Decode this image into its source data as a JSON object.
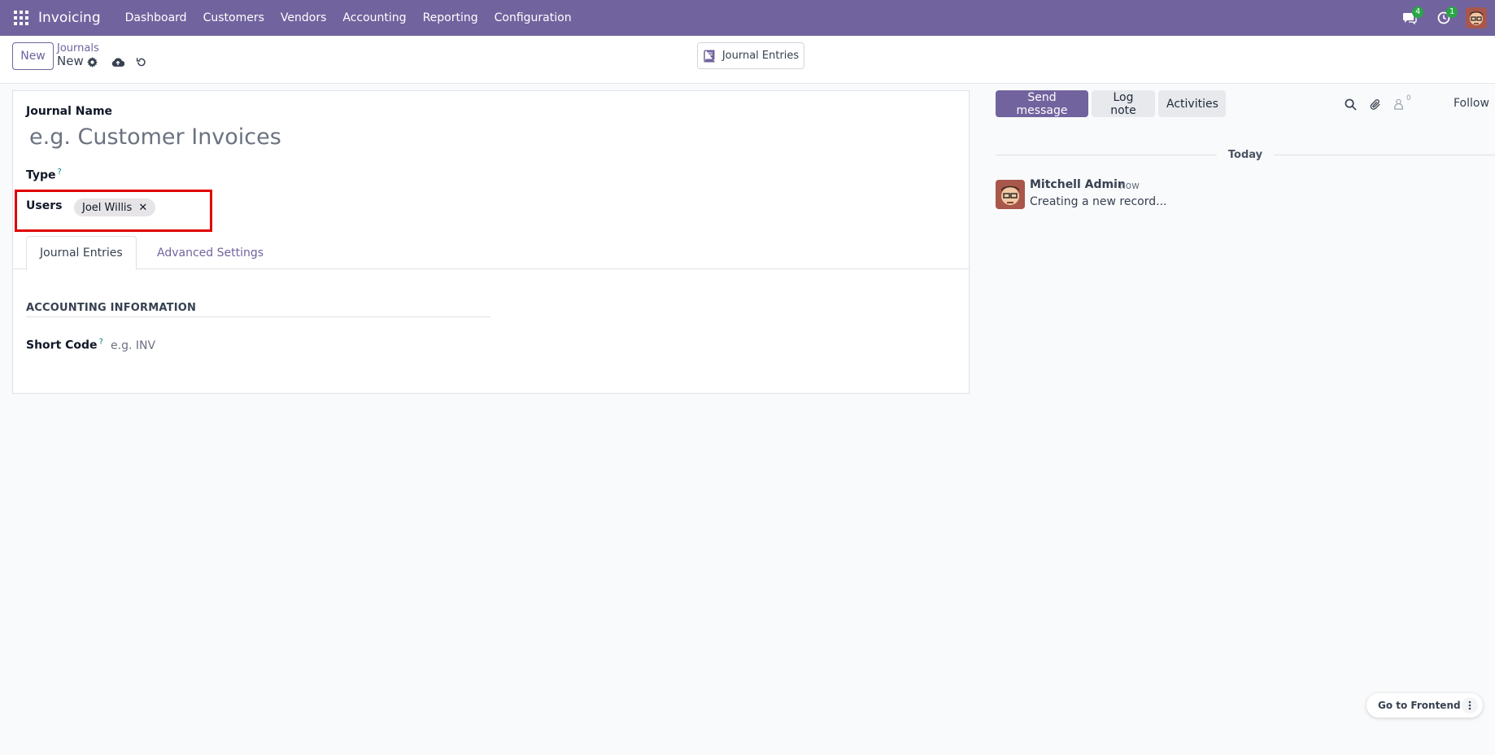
{
  "navbar": {
    "app_title": "Invoicing",
    "menu": [
      "Dashboard",
      "Customers",
      "Vendors",
      "Accounting",
      "Reporting",
      "Configuration"
    ],
    "messages_badge": "4",
    "activities_badge": "1",
    "brand_color": "#71639e"
  },
  "control_panel": {
    "new_label": "New",
    "breadcrumb_parent": "Journals",
    "breadcrumb_current": "New",
    "smart_button_label": "Journal Entries"
  },
  "form": {
    "journal_name_label": "Journal Name",
    "journal_name_placeholder": "e.g. Customer Invoices",
    "type_label": "Type",
    "help_mark": "?",
    "users_label": "Users",
    "user_tag": "Joel Willis",
    "tabs": [
      "Journal Entries",
      "Advanced Settings"
    ],
    "group_title": "ACCOUNTING INFORMATION",
    "short_code_label": "Short Code",
    "short_code_placeholder": "e.g. INV"
  },
  "chatter": {
    "send_message": "Send message",
    "log_note": "Log note",
    "activities": "Activities",
    "followers_count": "0",
    "follow": "Follow",
    "separator": "Today",
    "message": {
      "author": "Mitchell Admin",
      "date": "- now",
      "body": "Creating a new record..."
    }
  },
  "frontend_button": {
    "label": "Go to Frontend"
  },
  "icons": {
    "apps": "apps-grid-icon",
    "messages": "chat-icon",
    "activities": "clock-icon",
    "gear": "gear-icon",
    "save": "cloud-upload-icon",
    "discard": "undo-icon",
    "book": "book-icon",
    "search": "search-icon",
    "attachment": "paperclip-icon",
    "followers": "user-icon",
    "more": "vertical-dots-icon"
  }
}
